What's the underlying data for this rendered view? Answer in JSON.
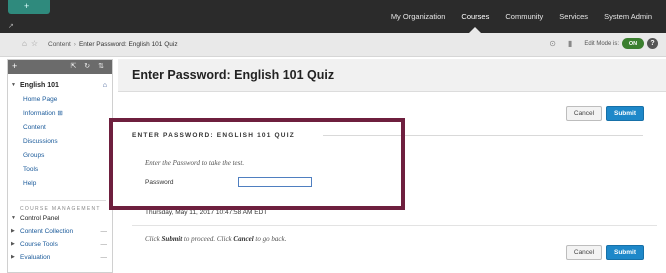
{
  "topbar": {
    "logo_glyph": "+",
    "corner_glyph": "↗",
    "nav": [
      {
        "label": "My Organization"
      },
      {
        "label": "Courses"
      },
      {
        "label": "Community"
      },
      {
        "label": "Services"
      },
      {
        "label": "System Admin"
      }
    ],
    "active_nav": "Courses"
  },
  "breadcrumb": {
    "icons": [
      "home-icon",
      "star-icon"
    ],
    "items": [
      "Content",
      "Enter Password: English 101 Quiz"
    ],
    "separator": "›",
    "edit_mode_label": "Edit Mode is:",
    "edit_mode_state": "ON",
    "help_glyph": "?"
  },
  "sidebar": {
    "toolbar_glyphs": {
      "add": "+",
      "tools": "⇱ ↻ ⇅"
    },
    "course_title": "English 101",
    "menu_items": [
      {
        "label": "Home Page"
      },
      {
        "label": "Information ⊞"
      },
      {
        "label": "Content"
      },
      {
        "label": "Discussions"
      },
      {
        "label": "Groups"
      },
      {
        "label": "Tools"
      },
      {
        "label": "Help"
      }
    ],
    "course_management_header": "COURSE MANAGEMENT",
    "control_panel": [
      {
        "label": "Control Panel",
        "bold": true
      },
      {
        "label": "Content Collection",
        "link": true
      },
      {
        "label": "Course Tools",
        "link": true
      },
      {
        "label": "Evaluation",
        "link": true
      }
    ],
    "dash": "—"
  },
  "main": {
    "page_title": "Enter Password: English 101 Quiz",
    "section_header": "ENTER PASSWORD: ENGLISH 101 QUIZ",
    "instruction": "Enter the Password to take the test.",
    "password_label": "Password",
    "password_value": "",
    "timestamp": "Thursday, May 11, 2017 10:47:58 AM EDT",
    "proceed_parts": {
      "click1": "Click ",
      "submit": "Submit",
      "mid": " to proceed. Click ",
      "cancel": "Cancel",
      "end": " to go back."
    },
    "cancel_label": "Cancel",
    "submit_label": "Submit"
  },
  "colors": {
    "highlight_border": "#6e1f3e",
    "submit_blue": "#1e88c9",
    "toggle_green": "#3b7f2f",
    "topbar": "#2b2b2b"
  }
}
